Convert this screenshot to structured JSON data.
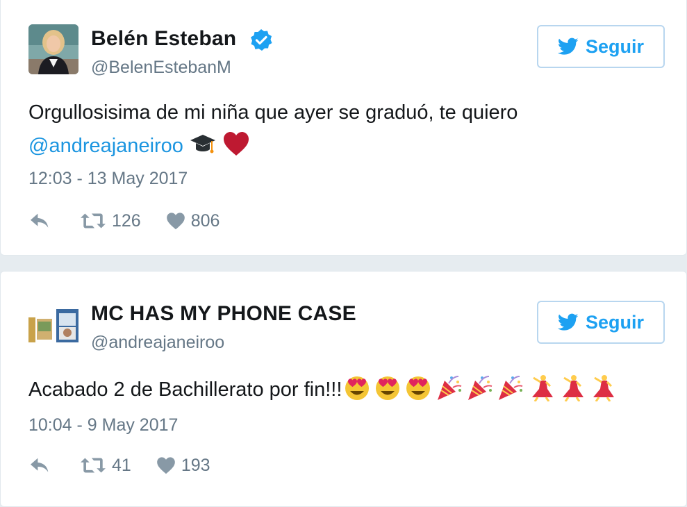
{
  "tweets": [
    {
      "display_name": "Belén Esteban",
      "verified": true,
      "handle": "@BelenEstebanM",
      "follow_label": "Seguir",
      "text_line1": "Orgullosisima de mi niña que ayer se graduó, te quiero",
      "mention": "@andreajaneiroo",
      "emojis": [
        "graduation-cap-icon",
        "red-heart-icon"
      ],
      "timestamp": "12:03 - 13 May 2017",
      "retweets": "126",
      "likes": "806"
    },
    {
      "display_name": "MC HAS MY PHONE CASE",
      "verified": false,
      "handle": "@andreajaneiroo",
      "follow_label": "Seguir",
      "text": "Acabado 2 de Bachillerato por fin!!!",
      "emojis": [
        "heart-eyes-icon",
        "heart-eyes-icon",
        "heart-eyes-icon",
        "party-popper-icon",
        "party-popper-icon",
        "party-popper-icon",
        "dancer-icon",
        "dancer-icon",
        "dancer-icon"
      ],
      "timestamp": "10:04 - 9 May 2017",
      "retweets": "41",
      "likes": "193"
    }
  ],
  "colors": {
    "link": "#1b95e0",
    "twitter_blue": "#1da1f2",
    "secondary_text": "#657786",
    "icon_gray": "#8899a6",
    "follow_border": "#b8d6ef"
  }
}
